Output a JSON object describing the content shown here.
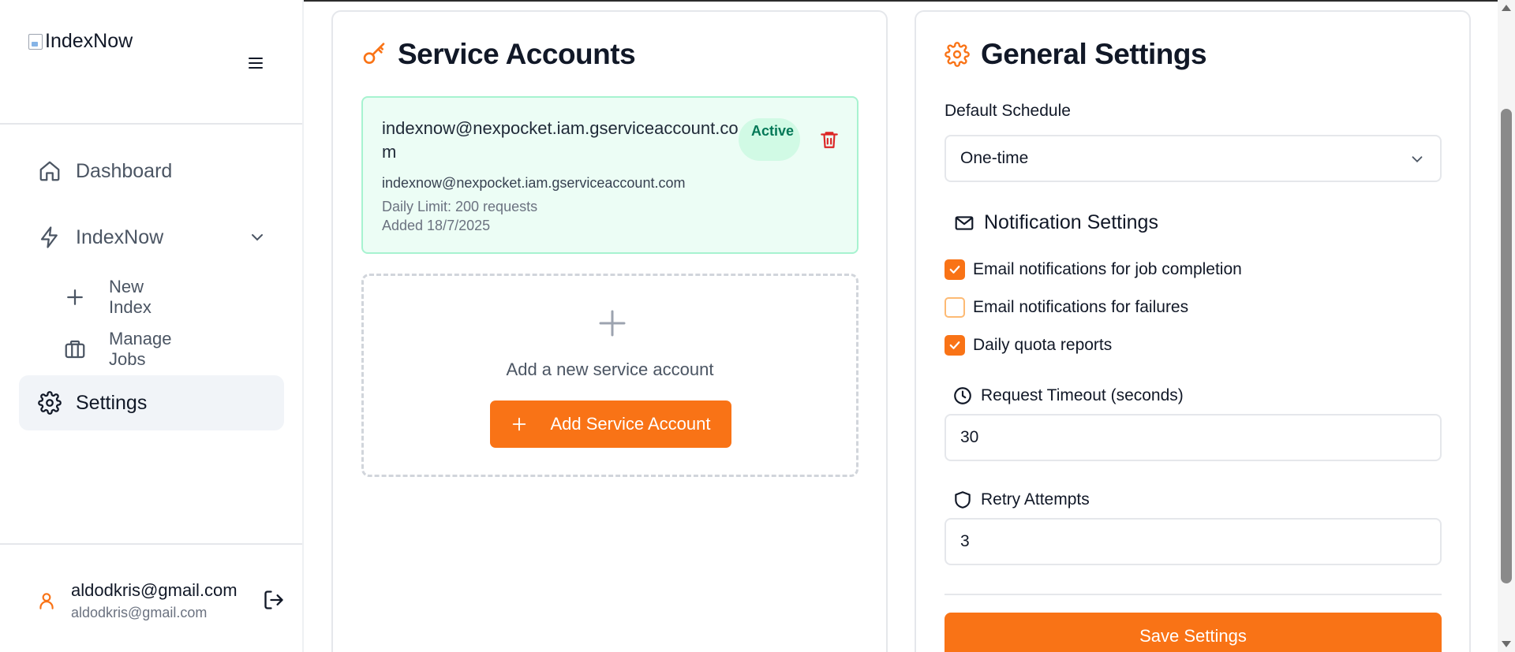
{
  "app": {
    "logo_text": "IndexNow",
    "accent": "#f97316"
  },
  "sidebar": {
    "items": [
      {
        "label": "Dashboard",
        "icon": "home-icon"
      },
      {
        "label": "IndexNow",
        "icon": "lightning-icon"
      },
      {
        "label": "New Index",
        "icon": "plus-icon"
      },
      {
        "label": "Manage Jobs",
        "icon": "briefcase-icon"
      },
      {
        "label": "Settings",
        "icon": "gear-icon",
        "active": true
      }
    ],
    "user": {
      "name": "aldodkris@gmail.com",
      "email": "aldodkris@gmail.com"
    }
  },
  "service_accounts": {
    "title": "Service Accounts",
    "accounts": [
      {
        "name": "indexnow@nexpocket.iam.gserviceaccount.com",
        "status": "Active",
        "email": "indexnow@nexpocket.iam.gserviceaccount.com",
        "daily_limit": "Daily Limit: 200 requests",
        "added": "Added 18/7/2025"
      }
    ],
    "add_text": "Add a new service account",
    "add_button": "Add Service Account"
  },
  "general_settings": {
    "title": "General Settings",
    "default_schedule_label": "Default Schedule",
    "default_schedule_value": "One-time",
    "notification_title": "Notification Settings",
    "notifications": [
      {
        "label": "Email notifications for job completion",
        "checked": true
      },
      {
        "label": "Email notifications for failures",
        "checked": false
      },
      {
        "label": "Daily quota reports",
        "checked": true
      }
    ],
    "timeout_label": "Request Timeout (seconds)",
    "timeout_value": "30",
    "retry_label": "Retry Attempts",
    "retry_value": "3",
    "save_button": "Save Settings"
  }
}
